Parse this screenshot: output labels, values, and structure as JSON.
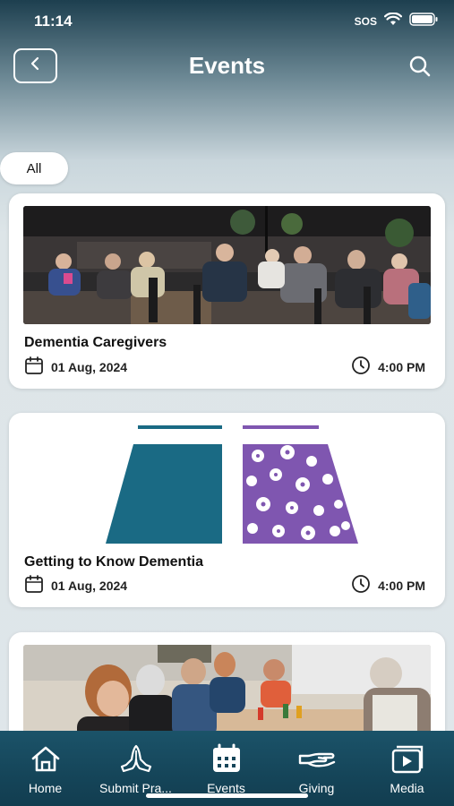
{
  "status_bar": {
    "time": "11:14",
    "sos": "SOS"
  },
  "header": {
    "title": "Events"
  },
  "filters": {
    "active": "All"
  },
  "events": [
    {
      "title": "Dementia Caregivers",
      "date": "01 Aug, 2024",
      "time": "4:00 PM"
    },
    {
      "title": "Getting to Know Dementia",
      "date": "01 Aug, 2024",
      "time": "4:00 PM"
    }
  ],
  "tabs": [
    {
      "label": "Home",
      "icon": "home-icon"
    },
    {
      "label": "Submit Pra...",
      "icon": "praying-hands-icon"
    },
    {
      "label": "Events",
      "icon": "calendar-icon"
    },
    {
      "label": "Giving",
      "icon": "giving-hand-icon"
    },
    {
      "label": "Media",
      "icon": "media-play-icon"
    }
  ],
  "colors": {
    "tab_bar": "#154559",
    "teal_block": "#1a6a84",
    "purple_block": "#7f56b0"
  }
}
